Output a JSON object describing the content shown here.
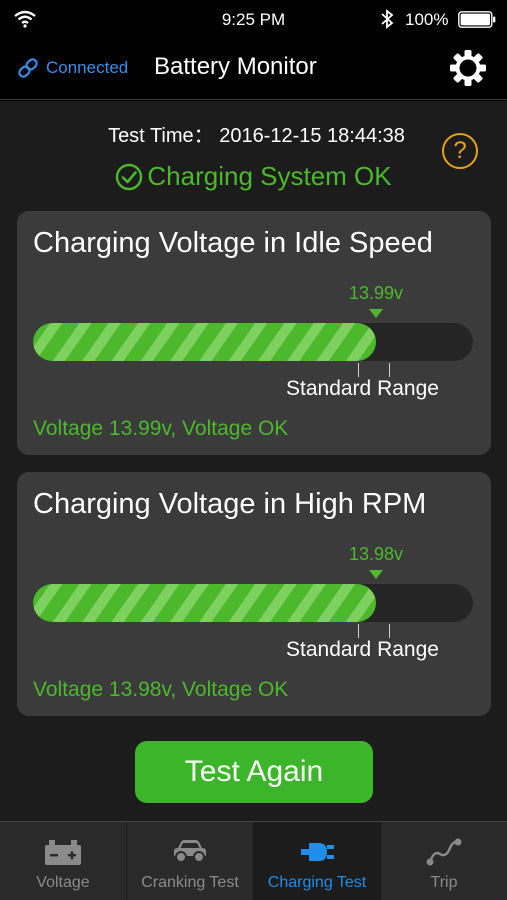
{
  "status_bar": {
    "time": "9:25 PM",
    "battery_pct": "100%"
  },
  "nav": {
    "connection": "Connected",
    "title": "Battery Monitor"
  },
  "test": {
    "time": "Test Time： 2016-12-15 18:44:38",
    "status": "Charging System OK"
  },
  "cards": [
    {
      "heading": "Charging Voltage in Idle Speed",
      "value_label": "13.99v",
      "fill_fraction": 0.78,
      "range_label": "Standard Range",
      "result": "Voltage 13.99v, Voltage OK"
    },
    {
      "heading": "Charging Voltage in High RPM",
      "value_label": "13.98v",
      "fill_fraction": 0.78,
      "range_label": "Standard Range",
      "result": "Voltage 13.98v, Voltage OK"
    }
  ],
  "buttons": {
    "test_again": "Test Again",
    "help": "?"
  },
  "tabs": [
    {
      "label": "Voltage",
      "icon": "battery-icon",
      "active": false
    },
    {
      "label": "Cranking Test",
      "icon": "car-icon",
      "active": false
    },
    {
      "label": "Charging Test",
      "icon": "plug-icon",
      "active": true
    },
    {
      "label": "Trip",
      "icon": "route-icon",
      "active": false
    }
  ],
  "colors": {
    "accent_green": "#4cb82c",
    "accent_blue": "#1e8ee8",
    "help_orange": "#e8a21a"
  }
}
